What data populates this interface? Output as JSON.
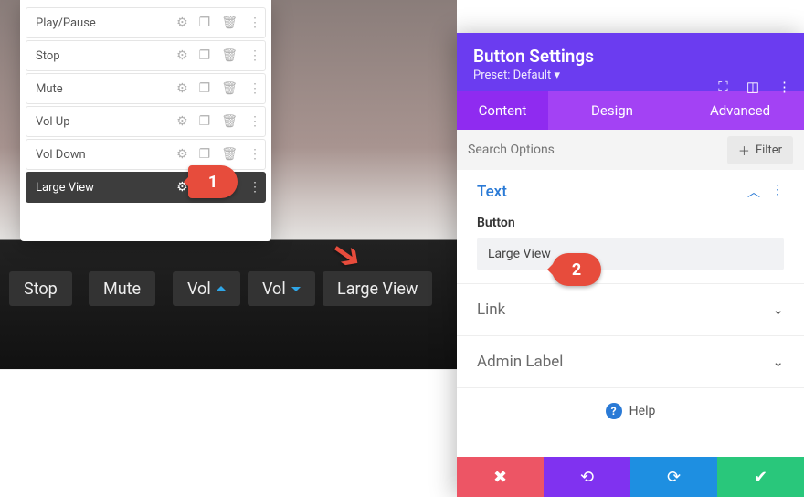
{
  "modules": [
    {
      "label": "Play/Pause"
    },
    {
      "label": "Stop"
    },
    {
      "label": "Mute"
    },
    {
      "label": "Vol Up"
    },
    {
      "label": "Vol Down"
    },
    {
      "label": "Large View",
      "active": true
    }
  ],
  "preview_buttons": {
    "stop": "Stop",
    "mute": "Mute",
    "vol_up": "Vol",
    "vol_down": "Vol",
    "large_view": "Large View"
  },
  "callouts": {
    "one": "1",
    "two": "2"
  },
  "panel": {
    "title": "Button Settings",
    "preset_label": "Preset: Default",
    "tabs": {
      "content": "Content",
      "design": "Design",
      "advanced": "Advanced"
    },
    "search_placeholder": "Search Options",
    "filter_label": "Filter",
    "sections": {
      "text": {
        "title": "Text",
        "field_label": "Button",
        "field_value": "Large View"
      },
      "link": "Link",
      "admin_label": "Admin Label"
    },
    "help": "Help"
  }
}
